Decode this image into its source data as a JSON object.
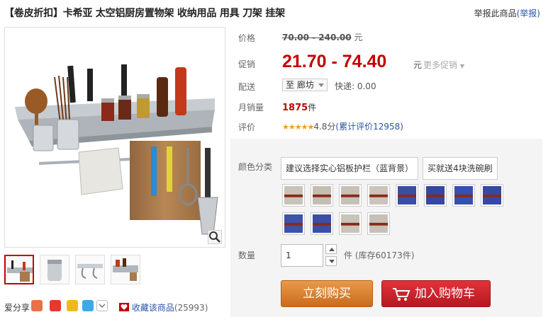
{
  "title": "【卷皮折扣】卡希亚 太空铝厨房置物架 收纳用品 用具 刀架 挂架",
  "report": {
    "text": "举报此商品",
    "link": "(举报)"
  },
  "labels": {
    "price": "价格",
    "promo": "促销",
    "delivery": "配送",
    "monthly_sales": "月销量",
    "rating": "评价",
    "color": "颜色分类",
    "quantity": "数量"
  },
  "price": {
    "original": "70.00 - 240.00",
    "currency": "元",
    "promo": "21.70 - 74.40",
    "promo_currency": "元",
    "more_promos": "更多促销"
  },
  "delivery": {
    "to_prefix": "至",
    "location": "廊坊",
    "shipping": "快递: 0.00"
  },
  "sales": {
    "count": "1875",
    "unit": "件"
  },
  "rating": {
    "stars": "★★★★★",
    "score": "4.8分",
    "total": "(累计评价12958)"
  },
  "color_options": [
    "建议选择实心铝板护栏（蓝背景）",
    "买就送4块洗碗刷"
  ],
  "swatch_colors": [
    "#c9c2b8",
    "#c4bdb3",
    "#c7c0b6",
    "#cbc4bc",
    "#3a4ea6",
    "#3448a2",
    "#3650ad",
    "#3549a4",
    "#3c53ab",
    "#3a4fa8",
    "#c9c3ba",
    "#c6c0b8"
  ],
  "quantity": {
    "value": "1",
    "unit": "件",
    "stock": "(库存60173件)"
  },
  "actions": {
    "buy_now": "立刻购买",
    "add_to_cart": "加入购物车"
  },
  "share": {
    "label": "爱分享"
  },
  "favorite": {
    "label": "收藏该商品",
    "count": "(25993)"
  }
}
